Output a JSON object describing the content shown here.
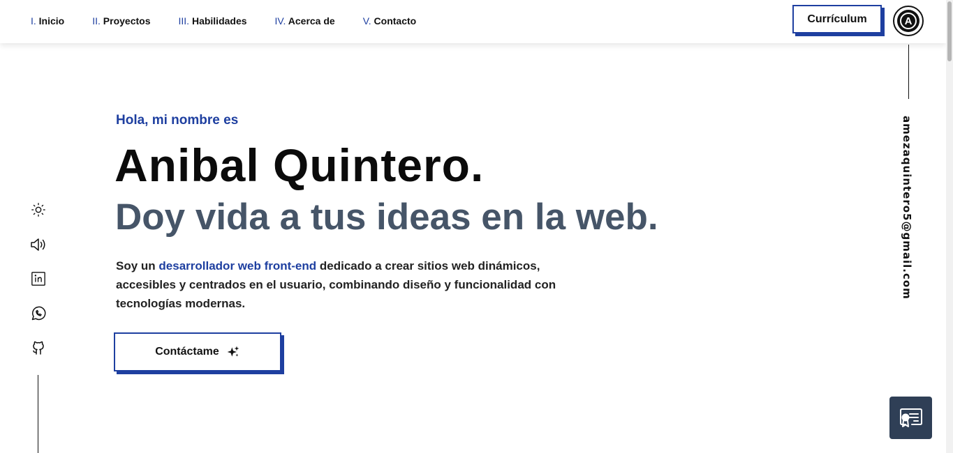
{
  "nav": {
    "items": [
      {
        "num": "I.",
        "label": "Inicio"
      },
      {
        "num": "II.",
        "label": "Proyectos"
      },
      {
        "num": "III.",
        "label": "Habilidades"
      },
      {
        "num": "IV.",
        "label": "Acerca de"
      },
      {
        "num": "V.",
        "label": "Contacto"
      }
    ],
    "cv_label": "Currículum",
    "logo_letter": "A"
  },
  "hero": {
    "greeting": "Hola, mi nombre es",
    "name": "Anibal Quintero.",
    "tagline": "Doy vida a tus ideas en la web.",
    "description": {
      "before": "Soy un ",
      "highlight": "desarrollador web front-end",
      "after": " dedicado a crear sitios web dinámicos, accesibles y centrados en el usuario, combinando diseño y funcionalidad con tecnologías modernas."
    },
    "cta_label": "Contáctame",
    "cta_icon": "sparkles-icon"
  },
  "sidebar_left": {
    "icons": [
      "sun-icon",
      "speaker-icon",
      "linkedin-icon",
      "whatsapp-icon",
      "github-icon"
    ]
  },
  "sidebar_right": {
    "email": "amezaquintero5@gmail.com"
  },
  "floating": {
    "icon": "certificate-icon"
  },
  "colors": {
    "accent": "#1e3fa0",
    "tagline": "#465568",
    "floating_bg": "#2f3f56"
  }
}
